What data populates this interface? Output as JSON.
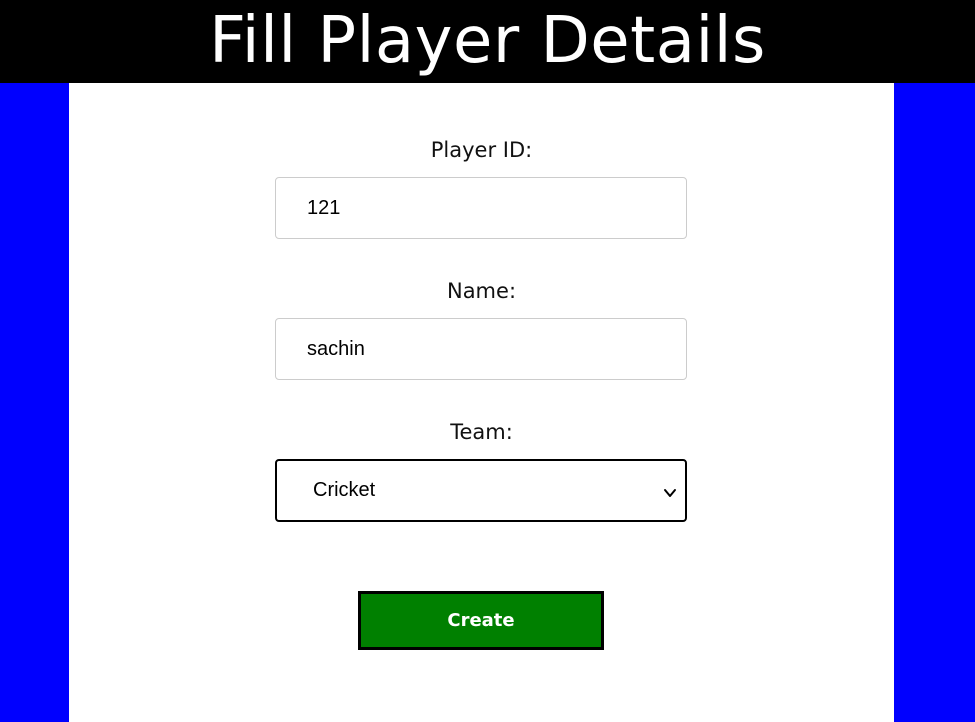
{
  "header": {
    "title": "Fill Player Details"
  },
  "form": {
    "player_id": {
      "label": "Player ID:",
      "value": "121"
    },
    "name": {
      "label": "Name:",
      "value": "sachin"
    },
    "team": {
      "label": "Team:",
      "selected": "Cricket"
    },
    "submit_label": "Create"
  },
  "colors": {
    "background": "#0000ff",
    "header_background": "#000000",
    "panel_background": "#ffffff",
    "button_background": "#008000"
  }
}
